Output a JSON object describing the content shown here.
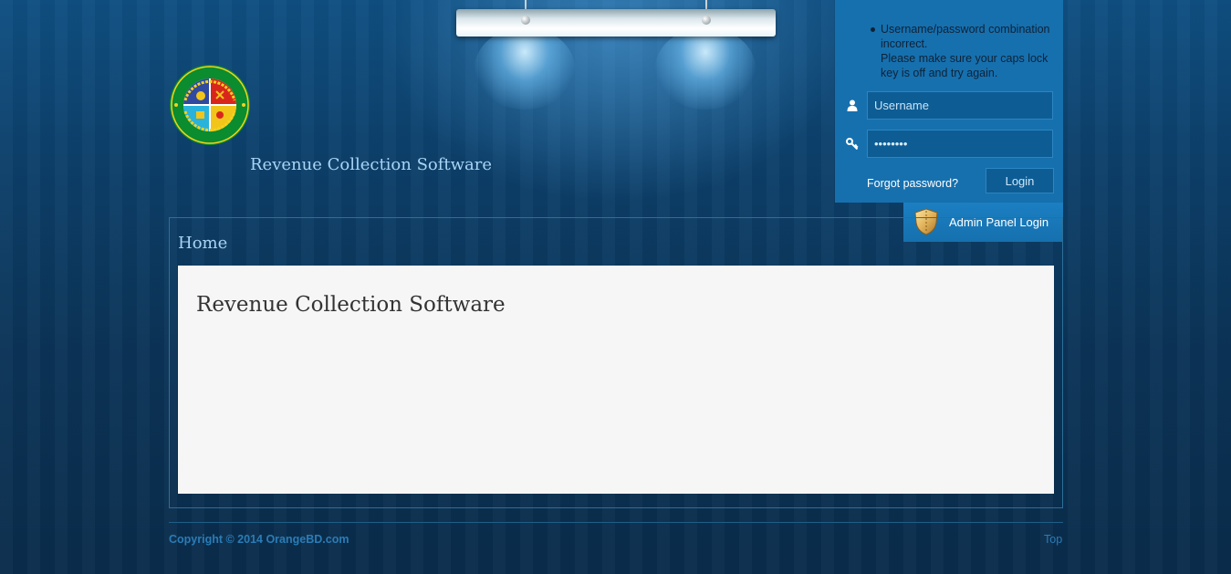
{
  "header": {
    "site_title": "Revenue Collection Software"
  },
  "login": {
    "errors": [
      "Username/password combination incorrect.",
      "Please make sure your caps lock key is off and try again."
    ],
    "username": {
      "placeholder": "Username",
      "value": ""
    },
    "password": {
      "value": "password"
    },
    "forgot_label": "Forgot password?",
    "login_label": "Login",
    "admin_label": "Admin Panel Login"
  },
  "main": {
    "heading": "Home",
    "content_title": "Revenue Collection Software"
  },
  "footer": {
    "copyright": "Copyright © 2014 OrangeBD.com",
    "top_label": "Top"
  },
  "colors": {
    "login_panel": "#1670ae",
    "background": "#0b3458",
    "content_bg": "#f6f6f6",
    "link": "#2a7cb6"
  }
}
